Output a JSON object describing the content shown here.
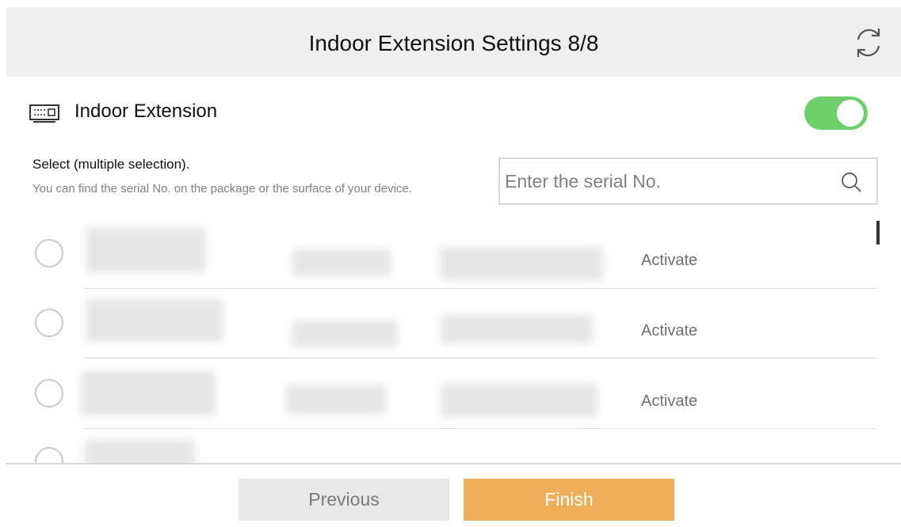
{
  "header": {
    "title": "Indoor Extension Settings 8/8",
    "refresh_icon": "refresh-icon"
  },
  "extension": {
    "label": "Indoor  Extension",
    "icon": "indoor-extension-device-icon",
    "toggle_on": true,
    "toggle_color": "#6dd06a"
  },
  "selection": {
    "title": "Select (multiple selection).",
    "hint": "You can find the serial No. on the package or the surface of your device."
  },
  "search": {
    "placeholder": "Enter the serial No.",
    "value": "",
    "icon": "search-icon"
  },
  "devices": [
    {
      "action": "Activate",
      "details": "blurred"
    },
    {
      "action": "Activate",
      "details": "blurred"
    },
    {
      "action": "Activate",
      "details": "blurred"
    },
    {
      "action": "",
      "details": "blurred"
    }
  ],
  "footer": {
    "previous_label": "Previous",
    "finish_label": "Finish",
    "finish_color": "#f0ae5a"
  }
}
